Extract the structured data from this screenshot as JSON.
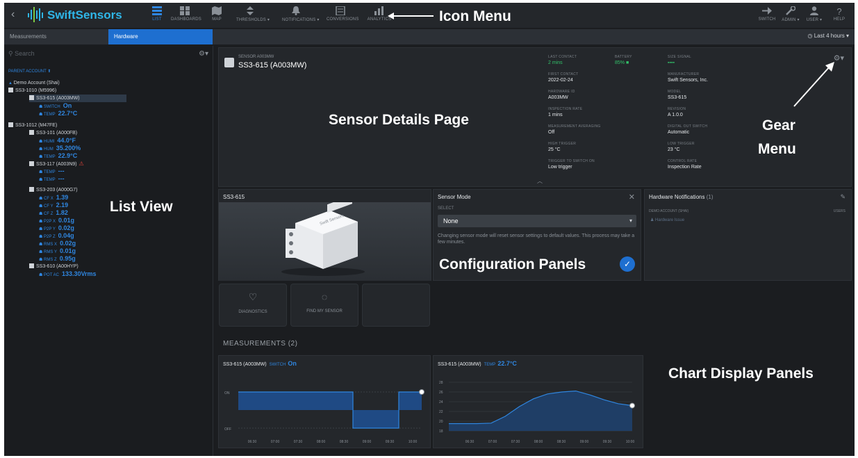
{
  "app": {
    "logo": "SwiftSensors",
    "nav": [
      {
        "label": "LIST",
        "icon": "list-icon",
        "active": true
      },
      {
        "label": "DASHBOARDS",
        "icon": "dashboard-icon"
      },
      {
        "label": "MAP",
        "icon": "map-icon"
      },
      {
        "label": "THRESHOLDS ▾",
        "icon": "thresholds-icon"
      },
      {
        "label": "NOTIFICATIONS ▾",
        "icon": "bell-icon"
      },
      {
        "label": "CONVERSIONS",
        "icon": "conversions-icon"
      },
      {
        "label": "ANALYTICS",
        "icon": "analytics-icon"
      }
    ],
    "right_nav": [
      {
        "label": "SWITCH",
        "icon": "switch-icon"
      },
      {
        "label": "ADMIN ▾",
        "icon": "wrench-icon"
      },
      {
        "label": "USER ▾",
        "icon": "user-icon"
      },
      {
        "label": "HELP",
        "icon": "help-icon"
      }
    ]
  },
  "annotations": {
    "icon_menu": "Icon Menu",
    "sensor_details": "Sensor Details Page",
    "gear_menu_1": "Gear",
    "gear_menu_2": "Menu",
    "list_view": "List View",
    "configuration_panels": "Configuration Panels",
    "chart_display_panels": "Chart Display Panels"
  },
  "subbar": {
    "tabs": [
      "Measurements",
      "Hardware"
    ],
    "time_filter": "Last 4 hours ▾"
  },
  "sidebar": {
    "search_placeholder": "Search",
    "parent_account": "PARENT ACCOUNT ⬆",
    "tree": [
      {
        "type": "account",
        "label": "Demo Account (Shai)"
      },
      {
        "type": "group",
        "label": "SS3-1010 (M5996)"
      },
      {
        "type": "device",
        "label": "SS3-615 (A003MW)",
        "selected": true
      },
      {
        "type": "measure",
        "key": "SWITCH",
        "value": "On"
      },
      {
        "type": "measure",
        "key": "TEMP",
        "value": "22.7°C"
      },
      {
        "type": "group",
        "label": "SS3-1012 (M47FE)"
      },
      {
        "type": "device",
        "label": "SS3-101 (A000FB)"
      },
      {
        "type": "measure",
        "key": "HUMI",
        "value": "44.0°F"
      },
      {
        "type": "measure",
        "key": "HUM",
        "value": "35.200%"
      },
      {
        "type": "measure",
        "key": "TEMP",
        "value": "22.9°C"
      },
      {
        "type": "device",
        "label": "SS3-117 (A003N9)",
        "warn": true
      },
      {
        "type": "measure",
        "key": "TEMP",
        "value": "---"
      },
      {
        "type": "measure",
        "key": "TEMP",
        "value": "---"
      },
      {
        "type": "device",
        "label": "SS3-203 (A000G7)"
      },
      {
        "type": "measure",
        "key": "CF X",
        "value": "1.39"
      },
      {
        "type": "measure",
        "key": "CF Y",
        "value": "2.19"
      },
      {
        "type": "measure",
        "key": "CF Z",
        "value": "1.82"
      },
      {
        "type": "measure",
        "key": "P2P X",
        "value": "0.01g"
      },
      {
        "type": "measure",
        "key": "P2P Y",
        "value": "0.02g"
      },
      {
        "type": "measure",
        "key": "P2P Z",
        "value": "0.04g"
      },
      {
        "type": "measure",
        "key": "RMS X",
        "value": "0.02g"
      },
      {
        "type": "measure",
        "key": "RMS Y",
        "value": "0.01g"
      },
      {
        "type": "measure",
        "key": "RMS Z",
        "value": "0.95g"
      },
      {
        "type": "device",
        "label": "SS3-610 (A00HYP)"
      },
      {
        "type": "measure",
        "key": "POT AC",
        "value": "133.30Vrms"
      }
    ]
  },
  "details": {
    "sub": "SENSOR  A003MW",
    "name": "SS3-615 (A003MW)",
    "fields": [
      {
        "label": "LAST CONTACT",
        "value": "2 mins",
        "green": true
      },
      {
        "label": "BATTERY",
        "value": "85% ■",
        "green": true
      },
      {
        "label": "FIRST CONTACT",
        "value": "2022-02-24"
      },
      {
        "label": "HARDWARE ID",
        "value": "A003MW"
      },
      {
        "label": "INSPECTION RATE",
        "value": "1 mins"
      },
      {
        "label": "MEASUREMENT AVERAGING",
        "value": "Off"
      },
      {
        "label": "HIGH TRIGGER",
        "value": "25 °C"
      },
      {
        "label": "TRIGGER TO SWITCH ON",
        "value": "Low trigger"
      },
      {
        "label": "SIZE SIGNAL",
        "value": "▪▪▪▪",
        "green": true
      },
      {
        "label": "MANUFACTURER",
        "value": "Swift Sensors, Inc."
      },
      {
        "label": "MODEL",
        "value": "SS3-615"
      },
      {
        "label": "REVISION",
        "value": "A 1.0.0"
      },
      {
        "label": "DIGITAL OUT SWITCH",
        "value": "Automatic"
      },
      {
        "label": "LOW TRIGGER",
        "value": "23 °C"
      },
      {
        "label": "CONTROL RATE",
        "value": "Inspection Rate"
      }
    ]
  },
  "device_panel": {
    "title": "SS3-615",
    "brand": "Swift Sensors"
  },
  "buttons": [
    {
      "label": "DIAGNOSTICS",
      "icon": "heart-icon"
    },
    {
      "label": "FIND MY SENSOR",
      "icon": "target-icon"
    }
  ],
  "mode_panel": {
    "title": "Sensor Mode",
    "select_label": "SELECT",
    "selected": "None",
    "note": "Changing sensor mode will reset sensor settings to default values. This process may take a few minutes."
  },
  "hw_panel": {
    "title": "Hardware Notifications",
    "count": "(1)",
    "col_left": "DEMO ACCOUNT (SHAI)",
    "col_right": "USERS",
    "item": "Hardware Issue"
  },
  "measurements": {
    "title": "MEASUREMENTS (2)"
  },
  "chart_data": [
    {
      "type": "line",
      "title": "SS3-615 (A003MW)",
      "key": "SWITCH",
      "current": "On",
      "x": [
        "06:30",
        "07:00",
        "07:30",
        "08:00",
        "08:30",
        "09:00",
        "09:30",
        "10:00"
      ],
      "y_categories": [
        "OFF",
        "ON"
      ],
      "series": [
        {
          "values": [
            1,
            1,
            1,
            1,
            1,
            0,
            0,
            1,
            1
          ]
        }
      ]
    },
    {
      "type": "area",
      "title": "SS3-615 (A003MW)",
      "key": "TEMP",
      "current": "22.7°C",
      "x": [
        "06:30",
        "07:00",
        "07:30",
        "08:00",
        "08:30",
        "09:00",
        "09:30",
        "10:00"
      ],
      "y_ticks": [
        18,
        20,
        22,
        24,
        26,
        28
      ],
      "ylim": [
        18,
        28
      ],
      "series": [
        {
          "values": [
            19.5,
            19.5,
            19.5,
            19.6,
            21,
            23,
            24.6,
            25.6,
            26,
            26.2,
            25.4,
            24.4,
            23.6,
            23.2
          ]
        }
      ]
    }
  ]
}
